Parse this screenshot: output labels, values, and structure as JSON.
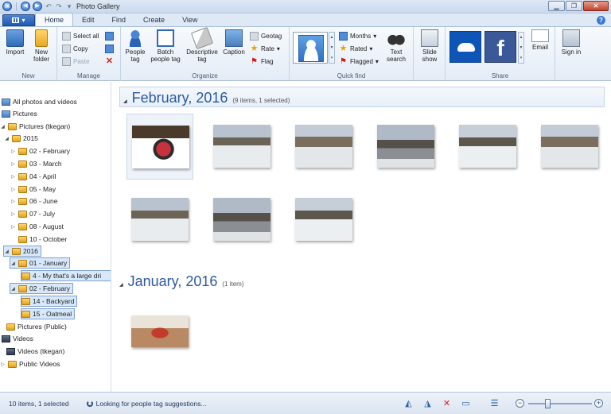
{
  "window": {
    "title": "Photo Gallery"
  },
  "tabs": [
    "Home",
    "Edit",
    "Find",
    "Create",
    "View"
  ],
  "ribbon": {
    "new": {
      "label": "New",
      "import": "Import",
      "new_folder": "New folder"
    },
    "manage": {
      "label": "Manage",
      "select_all": "Select all",
      "copy": "Copy",
      "paste": "Paste"
    },
    "organize": {
      "label": "Organize",
      "people_tag": "People tag",
      "batch_people_tag": "Batch people tag",
      "descriptive_tag": "Descriptive tag",
      "caption": "Caption",
      "geotag": "Geotag",
      "rate": "Rate",
      "flag": "Flag"
    },
    "quickfind": {
      "label": "Quick find",
      "months": "Months",
      "rated": "Rated",
      "flagged": "Flagged",
      "text_search": "Text search",
      "slide_show": "Slide show"
    },
    "share": {
      "label": "Share",
      "email": "Email",
      "sign_in": "Sign in"
    }
  },
  "sidebar": {
    "all": "All photos and videos",
    "pictures": "Pictures",
    "pictures_user": "Pictures (tkegan)",
    "y2015": "2015",
    "months2015": [
      "02 - February",
      "03 - March",
      "04 - April",
      "05 - May",
      "06 - June",
      "07 - July",
      "08 - August",
      "10 - October"
    ],
    "y2016": "2016",
    "jan": "01 - January",
    "jan_sub": "4 - My that's a large dri",
    "feb": "02 - February",
    "feb_subs": [
      "14 - Backyard",
      "15 - Oatmeal"
    ],
    "pictures_public": "Pictures (Public)",
    "videos": "Videos",
    "videos_user": "Videos (tkegan)",
    "videos_public": "Public Videos"
  },
  "groups": [
    {
      "title": "February, 2016",
      "count": "(9 items, 1 selected)"
    },
    {
      "title": "January, 2016",
      "count": "(1 item)"
    }
  ],
  "status": {
    "count": "10 items, 1 selected",
    "message": "Looking for people tag suggestions..."
  },
  "zoom": {
    "level": 0.3
  }
}
